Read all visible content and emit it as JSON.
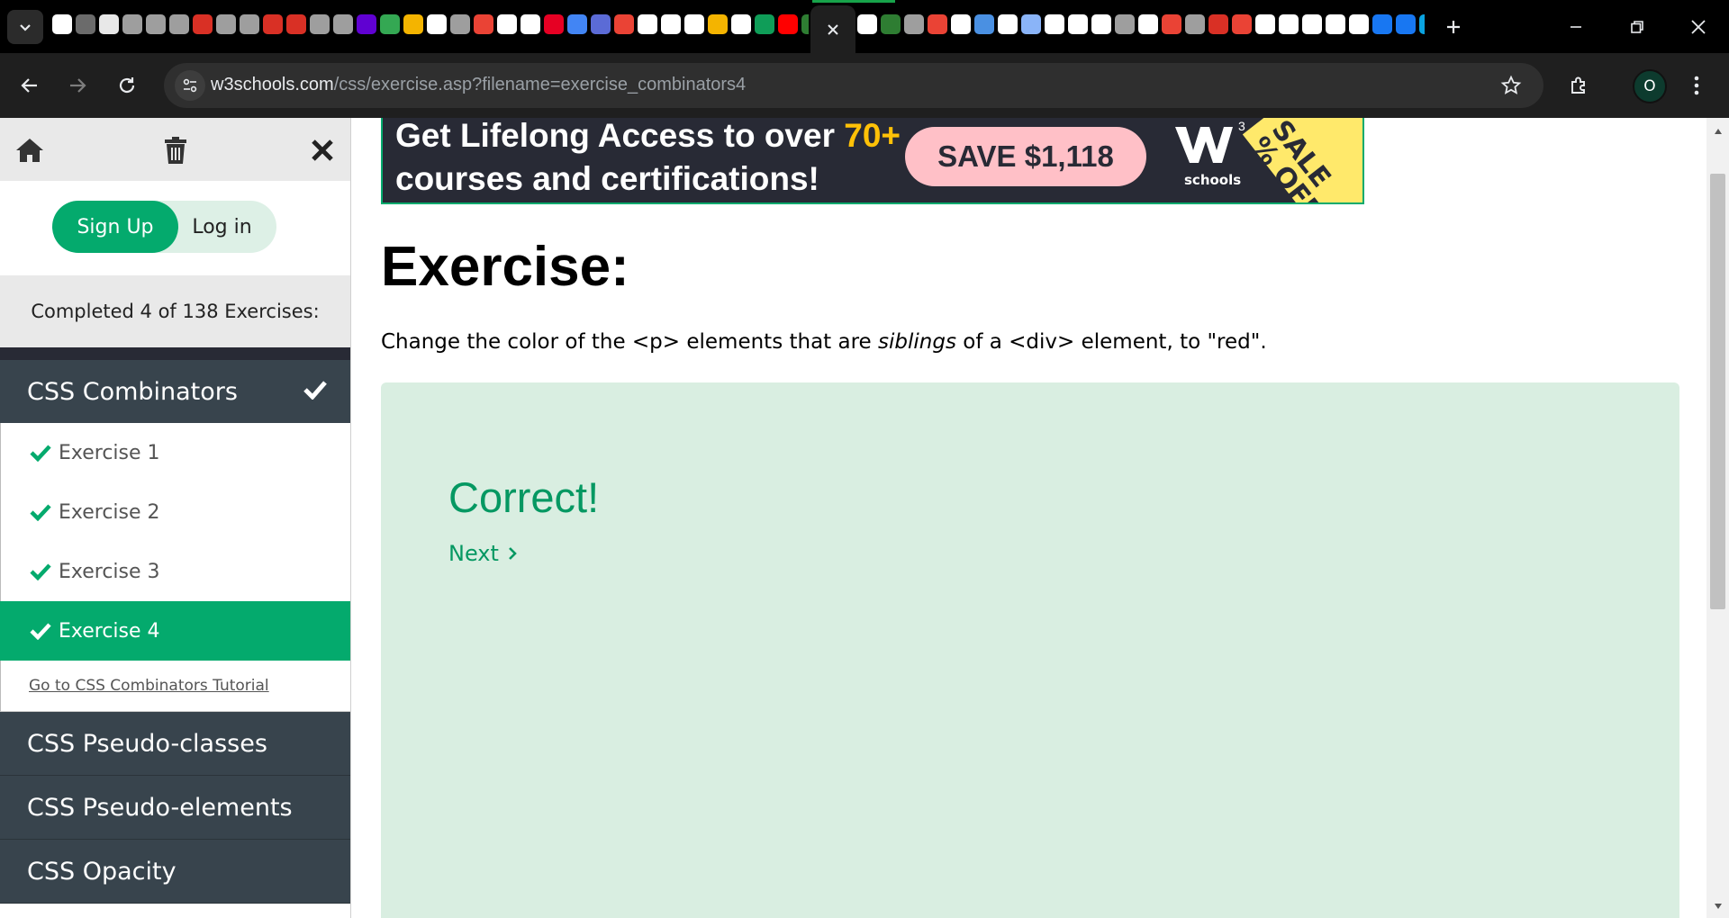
{
  "browser": {
    "url_host": "w3schools.com",
    "url_path": "/css/exercise.asp?filename=exercise_combinators4",
    "profile_initial": "O",
    "tab_colors_left": [
      "#ffffff",
      "#6b6b6b",
      "#e8e8e8",
      "#9e9e9e",
      "#9e9e9e",
      "#9e9e9e",
      "#d93025",
      "#9e9e9e",
      "#9e9e9e",
      "#d93025",
      "#d93025",
      "#9e9e9e",
      "#9e9e9e",
      "#6001d2",
      "#34a853",
      "#f4b400",
      "#ffffff",
      "#9e9e9e",
      "#ea4335",
      "#ffffff",
      "#ffffff",
      "#e60023",
      "#4285f4",
      "#5b6bd6",
      "#ea4335",
      "#ffffff",
      "#ffffff",
      "#ffffff",
      "#f4b400",
      "#ffffff",
      "#0f9d58",
      "#ff0000",
      "#2e7d32",
      "#2e7d32",
      "#2e7d32",
      "#ffffff",
      "#1da1f2",
      "#ffd54f",
      "#f4b400",
      "#ffffff"
    ],
    "tab_colors_right": [
      "#ffffff",
      "#2e7d32",
      "#9e9e9e",
      "#ea4335",
      "#ffffff",
      "#4a90e2",
      "#ffffff",
      "#8ab4f8",
      "#ffffff",
      "#ffffff",
      "#ffffff",
      "#9e9e9e",
      "#ffffff",
      "#ea4335",
      "#9e9e9e",
      "#d93025",
      "#ea4335",
      "#ffffff",
      "#ffffff",
      "#ffffff",
      "#ffffff",
      "#ffffff",
      "#1877f2",
      "#1877f2",
      "#0aa3e0",
      "#ff5722",
      "#b71cff",
      "#ffffff",
      "#4285f4",
      "#4285f4"
    ]
  },
  "sidebar": {
    "signup_label": "Sign Up",
    "login_label": "Log in",
    "completed_text": "Completed 4 of 138 Exercises:",
    "active_group": "CSS Combinators",
    "exercises": [
      {
        "label": "Exercise 1",
        "done": true
      },
      {
        "label": "Exercise 2",
        "done": true
      },
      {
        "label": "Exercise 3",
        "done": true
      },
      {
        "label": "Exercise 4",
        "done": true,
        "active": true
      }
    ],
    "tutorial_link": "Go to CSS Combinators Tutorial",
    "groups": [
      "CSS Pseudo-classes",
      "CSS Pseudo-elements",
      "CSS Opacity"
    ]
  },
  "banner": {
    "line1_prefix": "Get Lifelong Access to over ",
    "line1_highlight": "70+",
    "line2": "courses and certifications!",
    "save_label": "SAVE $1,118",
    "logo_text": "schools",
    "sale_text": "SALE % OFF"
  },
  "main": {
    "title": "Exercise:",
    "instruction_prefix": "Change the color of the <p> elements that are ",
    "instruction_em": "siblings",
    "instruction_suffix": " of a <div> element, to \"red\".",
    "result": "Correct!",
    "next_label": "Next"
  },
  "colors": {
    "accent_green": "#04aa6d",
    "sidebar_dark": "#38444d",
    "panel_green": "#d9eee1",
    "text_green": "#059862"
  }
}
